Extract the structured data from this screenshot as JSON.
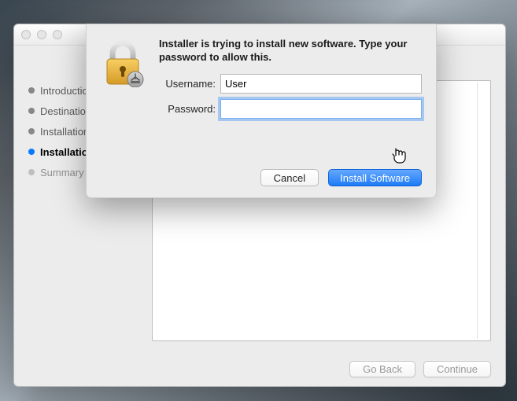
{
  "installer": {
    "steps": [
      {
        "label": "Introduction",
        "state": "done"
      },
      {
        "label": "Destination Select",
        "state": "done"
      },
      {
        "label": "Installation Type",
        "state": "done"
      },
      {
        "label": "Installation",
        "state": "current"
      },
      {
        "label": "Summary",
        "state": "future"
      }
    ],
    "go_back": "Go Back",
    "continue": "Continue"
  },
  "auth_dialog": {
    "message": "Installer is trying to install new software. Type your password to allow this.",
    "username_label": "Username:",
    "password_label": "Password:",
    "username_value": "User",
    "password_value": "",
    "cancel": "Cancel",
    "confirm": "Install Software"
  }
}
